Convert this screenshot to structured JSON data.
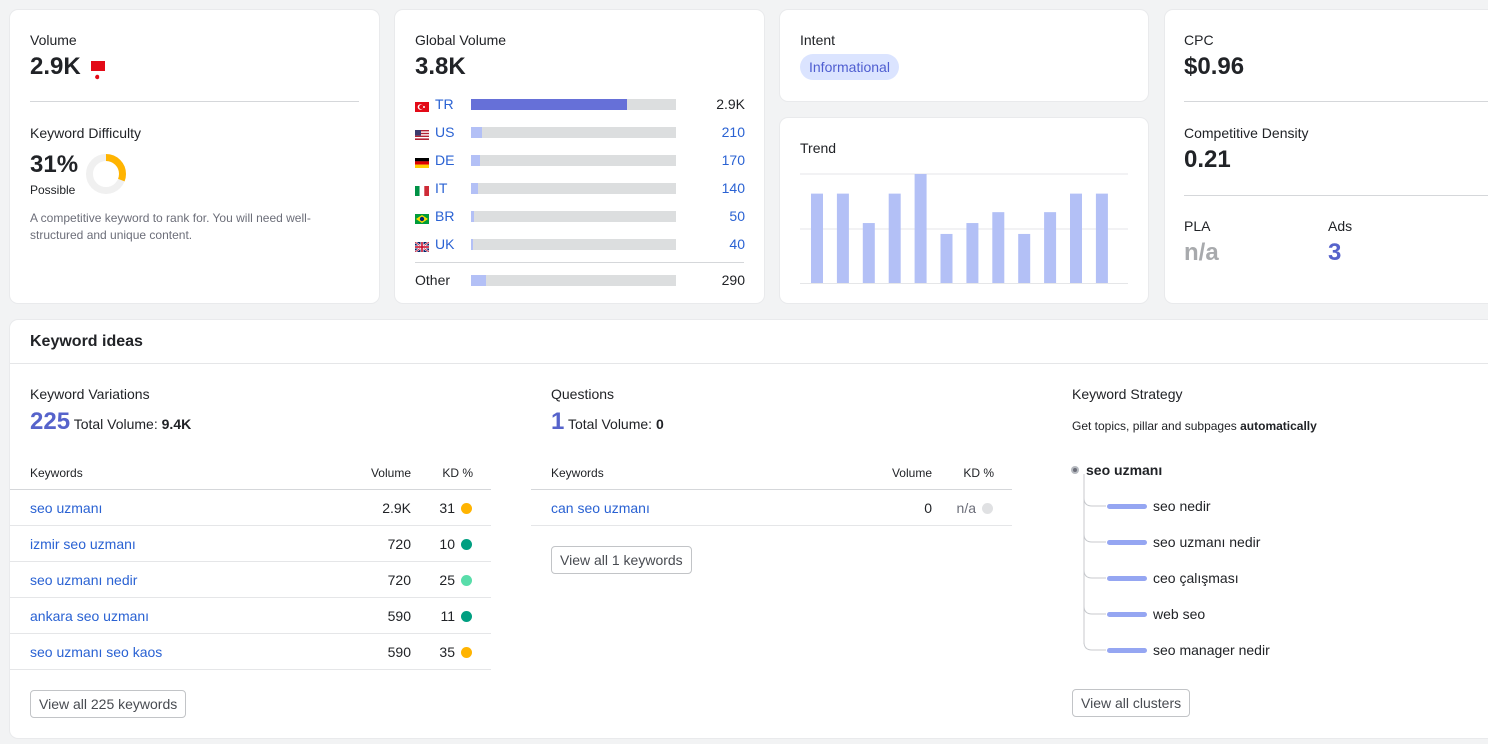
{
  "volume_card": {
    "label": "Volume",
    "value": "2.9K",
    "flag_icon": "turkey-flag-icon",
    "kd_label": "Keyword Difficulty",
    "kd_value": "31%",
    "kd_percent": 31,
    "kd_rating": "Possible",
    "kd_description": "A competitive keyword to rank for. You will need well-structured and unique content."
  },
  "global_card": {
    "label": "Global Volume",
    "value": "3.8K",
    "countries": [
      {
        "code": "TR",
        "value": "2.9K",
        "fill": 0.76,
        "fill_color": "#6670d8",
        "value_color": "#212327"
      },
      {
        "code": "US",
        "value": "210",
        "fill": 0.055,
        "fill_color": "#b3c0f6",
        "value_color": "#2a62d3"
      },
      {
        "code": "DE",
        "value": "170",
        "fill": 0.045,
        "fill_color": "#b3c0f6",
        "value_color": "#2a62d3"
      },
      {
        "code": "IT",
        "value": "140",
        "fill": 0.035,
        "fill_color": "#b3c0f6",
        "value_color": "#2a62d3"
      },
      {
        "code": "BR",
        "value": "50",
        "fill": 0.015,
        "fill_color": "#b3c0f6",
        "value_color": "#2a62d3"
      },
      {
        "code": "UK",
        "value": "40",
        "fill": 0.012,
        "fill_color": "#b3c0f6",
        "value_color": "#2a62d3"
      }
    ],
    "other_label": "Other",
    "other_value": "290",
    "other_fill": 0.075
  },
  "intent_card": {
    "label": "Intent",
    "badge": "Informational"
  },
  "trend_card": {
    "label": "Trend",
    "values": [
      0.82,
      0.82,
      0.55,
      0.82,
      1.0,
      0.45,
      0.55,
      0.65,
      0.45,
      0.65,
      0.82,
      0.82
    ]
  },
  "cpc_card": {
    "label": "CPC",
    "value": "$0.96",
    "density_label": "Competitive Density",
    "density_value": "0.21",
    "pla_label": "PLA",
    "pla_value": "n/a",
    "ads_label": "Ads",
    "ads_value": "3"
  },
  "ideas": {
    "title": "Keyword ideas",
    "variations": {
      "label": "Keyword Variations",
      "count": "225",
      "total_label": "Total Volume:",
      "total_value": "9.4K",
      "col_keywords": "Keywords",
      "col_volume": "Volume",
      "col_kd": "KD %",
      "rows": [
        {
          "keyword": "seo uzmanı",
          "volume": "2.9K",
          "kd": "31",
          "color": "#ffb401"
        },
        {
          "keyword": "izmir seo uzmanı",
          "volume": "720",
          "kd": "10",
          "color": "#009f81"
        },
        {
          "keyword": "seo uzmanı nedir",
          "volume": "720",
          "kd": "25",
          "color": "#59ddaa"
        },
        {
          "keyword": "ankara seo uzmanı",
          "volume": "590",
          "kd": "11",
          "color": "#009f81"
        },
        {
          "keyword": "seo uzmanı seo kaos",
          "volume": "590",
          "kd": "35",
          "color": "#ffb401"
        }
      ],
      "button": "View all 225 keywords"
    },
    "questions": {
      "label": "Questions",
      "count": "1",
      "total_label": "Total Volume:",
      "total_value": "0",
      "col_keywords": "Keywords",
      "col_volume": "Volume",
      "col_kd": "KD %",
      "rows": [
        {
          "keyword": "can seo uzmanı",
          "volume": "0",
          "kd": "n/a",
          "color": "#e0e1e3"
        }
      ],
      "button": "View all 1 keywords"
    },
    "strategy": {
      "label": "Keyword Strategy",
      "subtitle_prefix": "Get topics, pillar and subpages",
      "subtitle_bold": "automatically",
      "root": "seo uzmanı",
      "items": [
        "seo nedir",
        "seo uzmanı nedir",
        "ceo çalışması",
        "web seo",
        "seo manager nedir"
      ],
      "button": "View all clusters"
    }
  }
}
